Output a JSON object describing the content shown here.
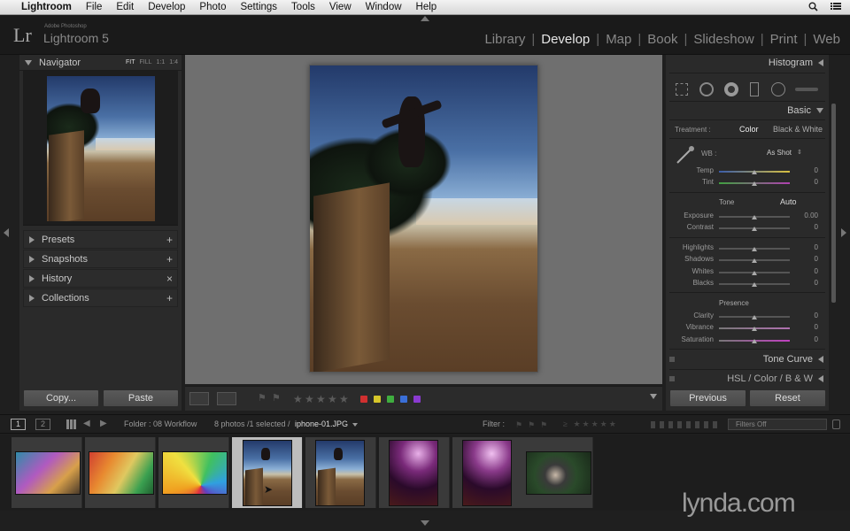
{
  "menubar": {
    "app_name": "Lightroom",
    "items": [
      "File",
      "Edit",
      "Develop",
      "Photo",
      "Settings",
      "Tools",
      "View",
      "Window",
      "Help"
    ]
  },
  "brand": {
    "logo": "Lr",
    "small_caption": "Adobe Photoshop",
    "product": "Lightroom 5"
  },
  "modules": [
    "Library",
    "Develop",
    "Map",
    "Book",
    "Slideshow",
    "Print",
    "Web"
  ],
  "active_module": "Develop",
  "left_panel": {
    "navigator": {
      "title": "Navigator",
      "zoom": [
        "FIT",
        "FILL",
        "1:1",
        "1:4"
      ],
      "selected_zoom": "FIT"
    },
    "sections": [
      {
        "label": "Presets",
        "action": "+"
      },
      {
        "label": "Snapshots",
        "action": "+"
      },
      {
        "label": "History",
        "action": "×"
      },
      {
        "label": "Collections",
        "action": "+"
      }
    ],
    "copy_button": "Copy...",
    "paste_button": "Paste"
  },
  "right_panel": {
    "histogram_title": "Histogram",
    "basic_title": "Basic",
    "treatment_label": "Treatment :",
    "treatment_color": "Color",
    "treatment_bw": "Black & White",
    "wb_label": "WB :",
    "wb_value": "As Shot",
    "tone_label": "Tone",
    "auto_label": "Auto",
    "presence_label": "Presence",
    "sliders": [
      {
        "label": "Temp",
        "value": "0"
      },
      {
        "label": "Tint",
        "value": "0"
      },
      {
        "label": "Exposure",
        "value": "0.00"
      },
      {
        "label": "Contrast",
        "value": "0"
      },
      {
        "label": "Highlights",
        "value": "0"
      },
      {
        "label": "Shadows",
        "value": "0"
      },
      {
        "label": "Whites",
        "value": "0"
      },
      {
        "label": "Blacks",
        "value": "0"
      },
      {
        "label": "Clarity",
        "value": "0"
      },
      {
        "label": "Vibrance",
        "value": "0"
      },
      {
        "label": "Saturation",
        "value": "0"
      }
    ],
    "tone_curve_title": "Tone Curve",
    "hsl_title": "HSL / Color / B & W",
    "previous_button": "Previous",
    "reset_button": "Reset"
  },
  "filmstrip_bar": {
    "page1": "1",
    "page2": "2",
    "folder": "Folder : 08 Workflow",
    "count": "8 photos /1 selected /",
    "filename": "iphone-01.JPG",
    "filter_label": "Filter :",
    "filter_value": "Filters Off"
  },
  "label_colors": [
    "#d03030",
    "#d6c62a",
    "#3fae3f",
    "#3a6fd8",
    "#8a3ad0"
  ],
  "watermark": "lynda.com"
}
